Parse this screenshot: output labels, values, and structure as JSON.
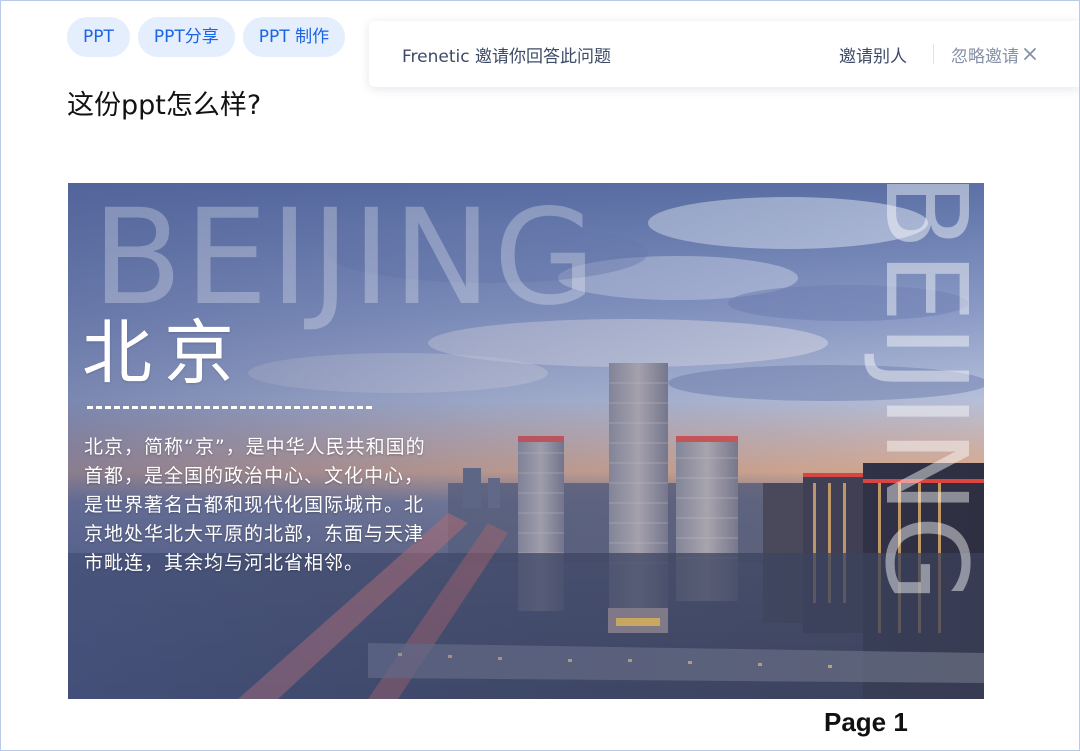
{
  "tags": [
    "PPT",
    "PPT分享",
    "PPT 制作"
  ],
  "question": {
    "title": "这份ppt怎么样?"
  },
  "invite": {
    "text": "Frenetic 邀请你回答此问题",
    "invite_others": "邀请别人",
    "ignore": "忽略邀请",
    "close_icon": "close-icon"
  },
  "slide": {
    "watermark": "BEIJING",
    "watermark_vertical": "BEIJING",
    "title": "北京",
    "description": "北京，简称“京”，是中华人民共和国的首都，是全国的政治中心、文化中心，是世界著名古都和现代化国际城市。北京地处华北大平原的北部，东面与天津市毗连，其余均与河北省相邻。"
  },
  "page_label": "Page 1",
  "colors": {
    "tag_bg": "#e5eefc",
    "tag_text": "#1a64e6",
    "invite_text": "#3d4a66",
    "ignore_text": "#8590a6",
    "frame_border": "#b9c9e6"
  }
}
